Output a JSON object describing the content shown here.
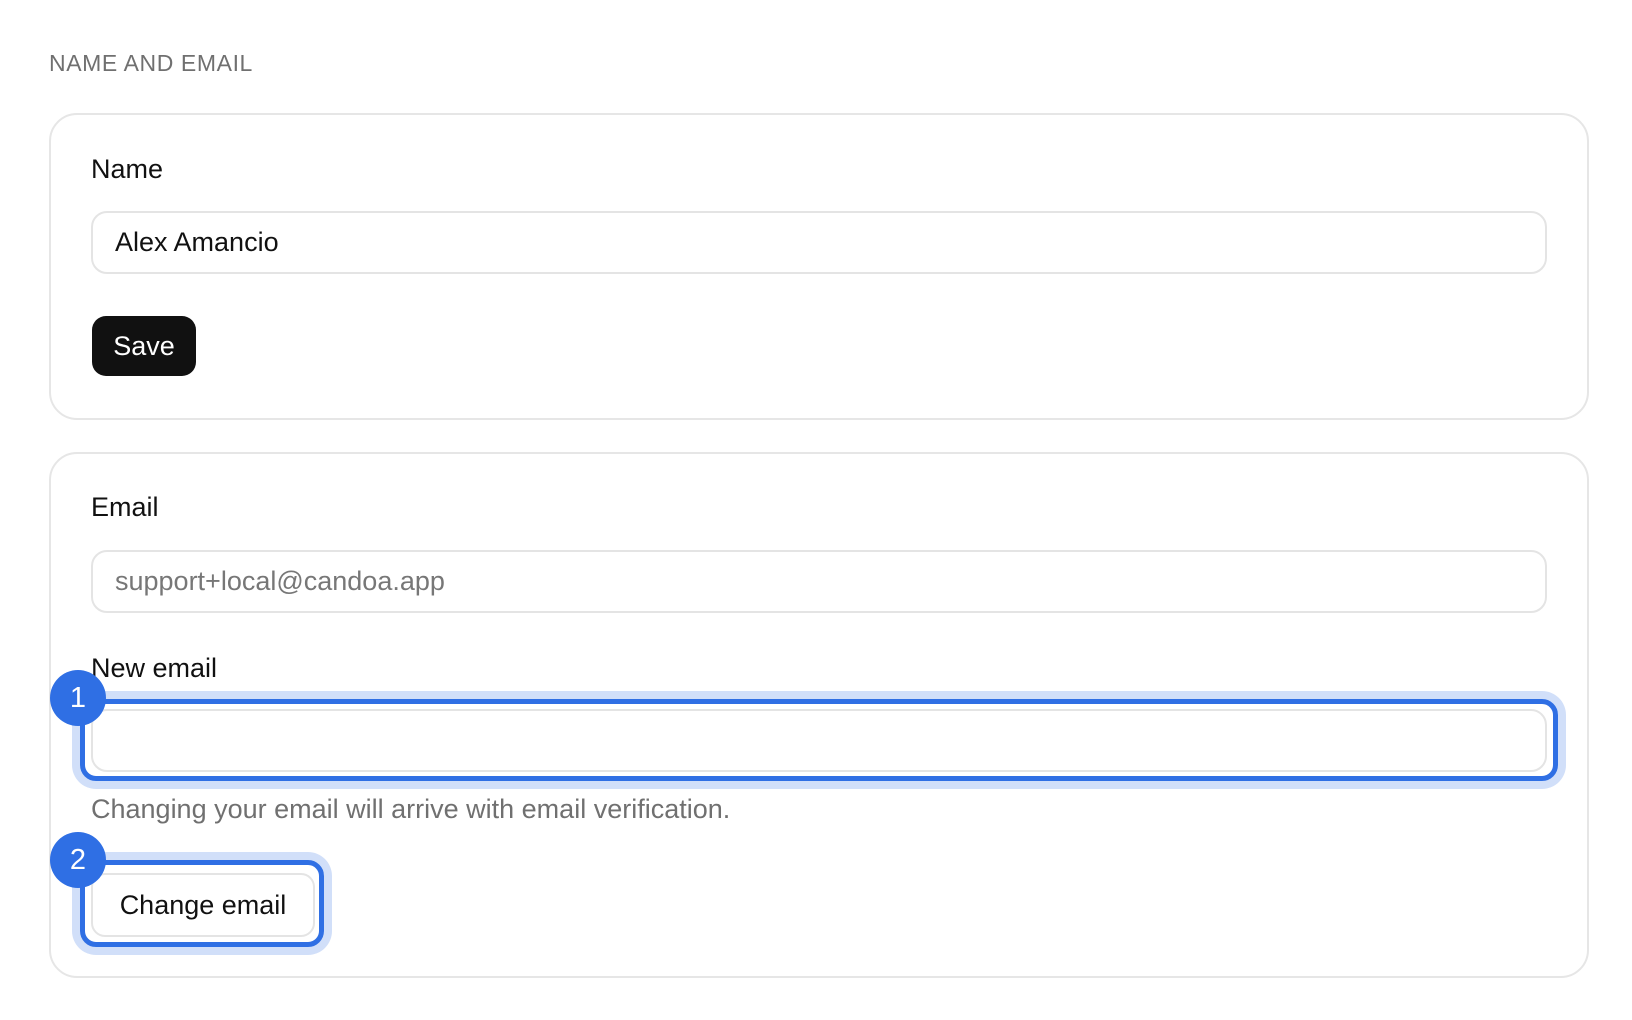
{
  "section": {
    "title": "NAME AND EMAIL"
  },
  "name_card": {
    "label": "Name",
    "value": "Alex Amancio",
    "save_label": "Save"
  },
  "email_card": {
    "email_label": "Email",
    "email_value": "support+local@candoa.app",
    "new_email_label": "New email",
    "new_email_value": "",
    "helper_text": "Changing your email will arrive with email verification.",
    "change_button_label": "Change email"
  },
  "annotations": [
    {
      "number": "1",
      "target": "new-email-input"
    },
    {
      "number": "2",
      "target": "change-email-button"
    }
  ],
  "colors": {
    "accent": "#2f6fe4",
    "primary_button": "#111111",
    "muted_text": "#707070"
  }
}
